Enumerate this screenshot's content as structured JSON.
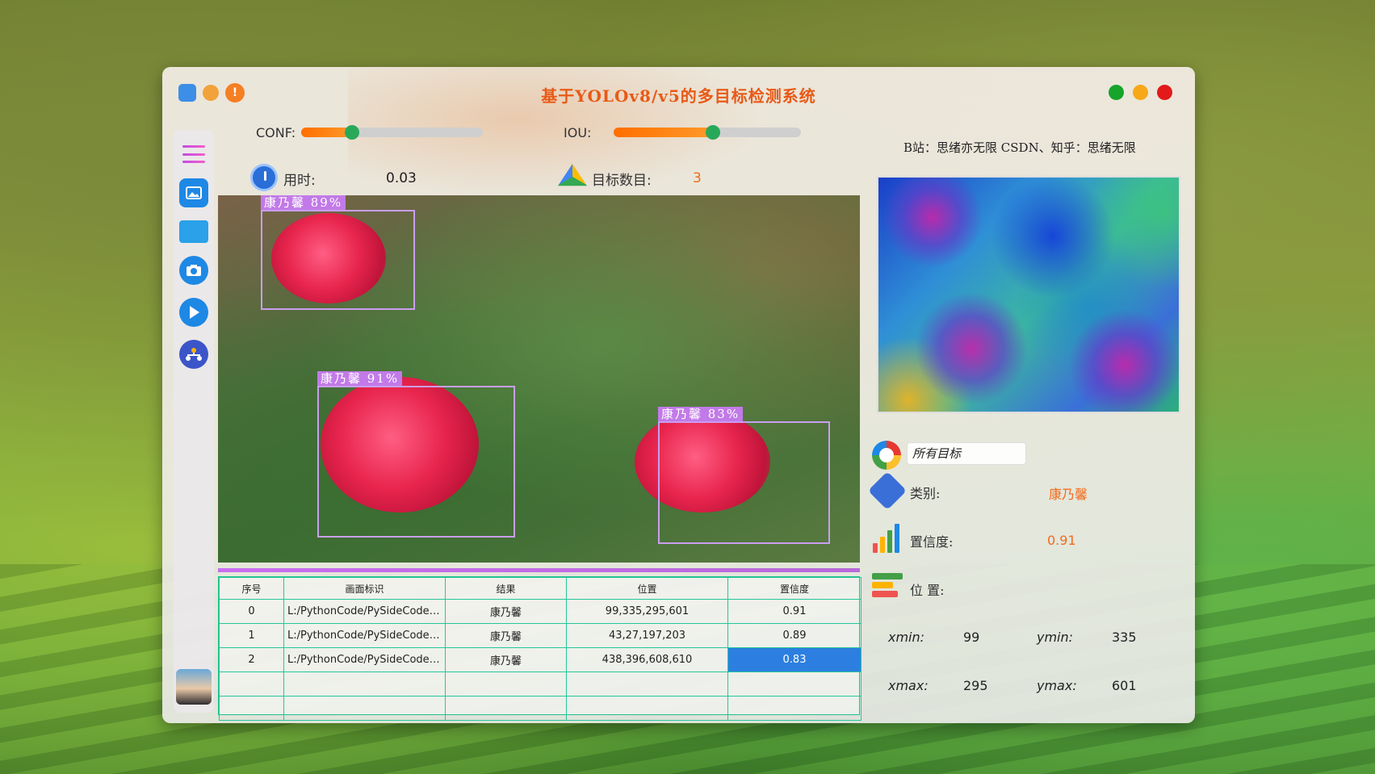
{
  "app": {
    "title": "基于YOLOv8/v5的多目标检测系统",
    "credit": "B站：思绪亦无限 CSDN、知乎：思绪无限"
  },
  "controls": {
    "conf_label": "CONF:",
    "conf_value": 0.3,
    "iou_label": "IOU:",
    "iou_value": 0.5
  },
  "stats": {
    "time_label": "用时:",
    "time_value": "0.03",
    "count_label": "目标数目:",
    "count_value": "3"
  },
  "detections": [
    {
      "label": "康乃馨 89%"
    },
    {
      "label": "康乃馨 91%"
    },
    {
      "label": "康乃馨 83%"
    }
  ],
  "table": {
    "headers": [
      "序号",
      "画面标识",
      "结果",
      "位置",
      "置信度"
    ],
    "rows": [
      [
        "0",
        "L:/PythonCode/PySideCode/...",
        "康乃馨",
        "99,335,295,601",
        "0.91"
      ],
      [
        "1",
        "L:/PythonCode/PySideCode/...",
        "康乃馨",
        "43,27,197,203",
        "0.89"
      ],
      [
        "2",
        "L:/PythonCode/PySideCode/...",
        "康乃馨",
        "438,396,608,610",
        "0.83"
      ]
    ]
  },
  "details": {
    "select_value": "所有目标",
    "class_label": "类别:",
    "class_value": "康乃馨",
    "conf_label": "置信度:",
    "conf_value": "0.91",
    "pos_label": "位 置:",
    "xmin_label": "xmin:",
    "xmin": "99",
    "ymin_label": "ymin:",
    "ymin": "335",
    "xmax_label": "xmax:",
    "xmax": "295",
    "ymax_label": "ymax:",
    "ymax": "601"
  },
  "colors": {
    "accent": "#f26a1b",
    "title": "#e85a17",
    "bbox": "#c99ef0",
    "table_border": "#25c79a",
    "selected": "#2c7fe0"
  },
  "icons": {
    "sidebar": [
      "menu-icon",
      "image-icon",
      "folder-icon",
      "camera-icon",
      "play-icon",
      "network-icon"
    ]
  }
}
